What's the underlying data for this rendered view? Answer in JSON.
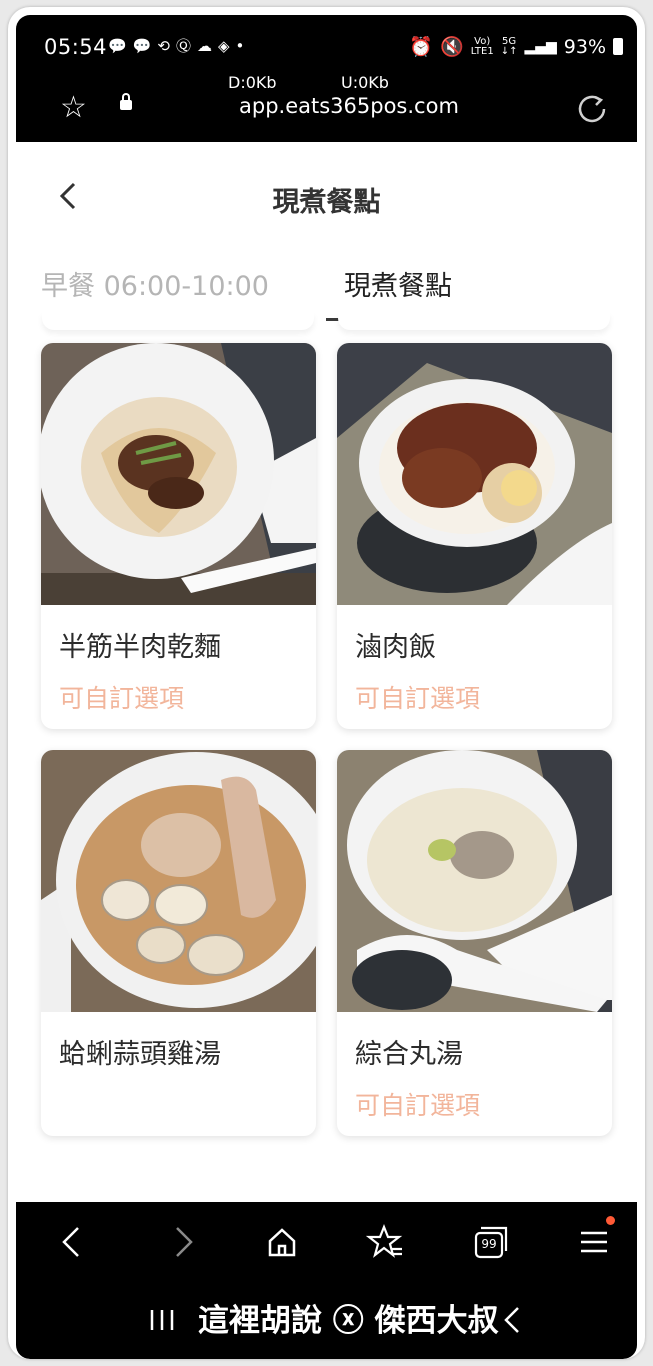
{
  "status_bar": {
    "time": "05:54",
    "notification_icons": [
      "line-icon",
      "line-icon",
      "sync-icon",
      "q-icon",
      "cloud-icon",
      "tag-icon",
      "dot-icon"
    ],
    "signal_label_top": "Vo)",
    "signal_label_bottom": "LTE1",
    "network": "5G",
    "battery": "93%"
  },
  "browser": {
    "download_speed": "D:0Kb",
    "upload_speed": "U:0Kb",
    "url": "app.eats365pos.com"
  },
  "header": {
    "title": "現煮餐點"
  },
  "tabs": [
    {
      "label": "早餐 06:00-10:00",
      "active": false
    },
    {
      "label": "現煮餐點",
      "active": true
    }
  ],
  "menu_items": [
    {
      "name": "半筋半肉乾麵",
      "option": "可自訂選項"
    },
    {
      "name": "滷肉飯",
      "option": "可自訂選項"
    },
    {
      "name": "蛤蜊蒜頭雞湯",
      "option": ""
    },
    {
      "name": "綜合丸湯",
      "option": "可自訂選項"
    }
  ],
  "bottom_nav": {
    "tabs_count": "99"
  },
  "watermark": "這裡胡說 ⓧ 傑西大叔",
  "colors": {
    "accent_option": "#f2b59b",
    "tab_inactive": "#b5b5b5",
    "notification_dot": "#ff5a36"
  }
}
